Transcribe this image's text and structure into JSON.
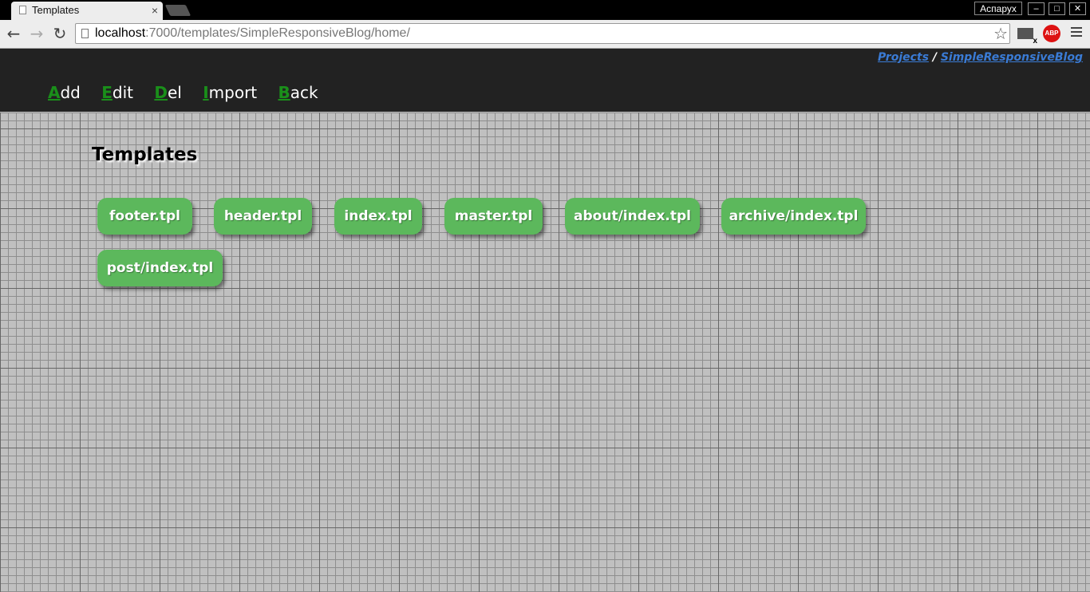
{
  "browser": {
    "tab_title": "Templates",
    "tab_close": "×",
    "user_name": "Аспарух",
    "url_host": "localhost",
    "url_rest": ":7000/templates/SimpleResponsiveBlog/home/",
    "window_buttons": [
      "–",
      "□",
      "✕"
    ],
    "extensions": [
      "mail-checker-icon",
      "adblock-plus-icon"
    ],
    "abp_label": "ABP",
    "mail_badge": "x"
  },
  "breadcrumb": {
    "projects": "Projects",
    "separator": "/",
    "current": "SimpleResponsiveBlog"
  },
  "menu": {
    "items": [
      {
        "key": "A",
        "rest": "dd"
      },
      {
        "key": "E",
        "rest": "dit"
      },
      {
        "key": "D",
        "rest": "el"
      },
      {
        "key": "I",
        "rest": "mport"
      },
      {
        "key": "B",
        "rest": "ack"
      }
    ]
  },
  "page": {
    "title": "Templates"
  },
  "templates": [
    "footer.tpl",
    "header.tpl",
    "index.tpl",
    "master.tpl",
    "about/index.tpl",
    "archive/index.tpl",
    "post/index.tpl"
  ],
  "colors": {
    "header_bg": "#222222",
    "accent_green": "#5cb85c",
    "hotkey_green": "#1a8f1a",
    "link_blue": "#3a7bd5",
    "grid_bg": "#c0c0c0"
  }
}
